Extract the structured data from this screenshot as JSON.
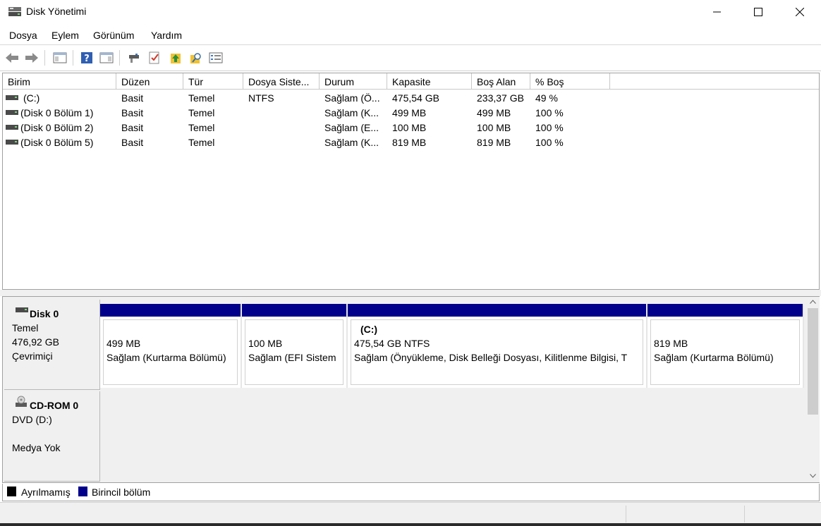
{
  "window": {
    "title": "Disk Yönetimi"
  },
  "menu": [
    "Dosya",
    "Eylem",
    "Görünüm",
    "Yardım"
  ],
  "toolbar": {
    "icons": [
      "back-arrow-icon",
      "forward-arrow-icon",
      "console-tree-icon",
      "help-icon",
      "action-pane-icon",
      "connect-disk-icon",
      "check-icon",
      "rescan-icon",
      "search-icon",
      "properties-icon"
    ]
  },
  "volume_list": {
    "columns": [
      "Birim",
      "Düzen",
      "Tür",
      "Dosya Siste...",
      "Durum",
      "Kapasite",
      "Boş Alan",
      "% Boş"
    ],
    "rows": [
      {
        "birim": "(C:)",
        "duzen": "Basit",
        "tur": "Temel",
        "dosya": "NTFS",
        "durum": "Sağlam (Ö...",
        "kapasite": "475,54 GB",
        "bos": "233,37 GB",
        "yuzde": "49 %"
      },
      {
        "birim": "(Disk 0 Bölüm 1)",
        "duzen": "Basit",
        "tur": "Temel",
        "dosya": "",
        "durum": "Sağlam (K...",
        "kapasite": "499 MB",
        "bos": "499 MB",
        "yuzde": "100 %"
      },
      {
        "birim": "(Disk 0 Bölüm 2)",
        "duzen": "Basit",
        "tur": "Temel",
        "dosya": "",
        "durum": "Sağlam (E...",
        "kapasite": "100 MB",
        "bos": "100 MB",
        "yuzde": "100 %"
      },
      {
        "birim": "(Disk 0 Bölüm 5)",
        "duzen": "Basit",
        "tur": "Temel",
        "dosya": "",
        "durum": "Sağlam (K...",
        "kapasite": "819 MB",
        "bos": "819 MB",
        "yuzde": "100 %"
      }
    ]
  },
  "disks": {
    "disk0": {
      "name": "Disk 0",
      "type": "Temel",
      "size": "476,92 GB",
      "status": "Çevrimiçi",
      "partitions": [
        {
          "label": "",
          "size": "499 MB",
          "status": "Sağlam (Kurtarma Bölümü)"
        },
        {
          "label": "",
          "size": "100 MB",
          "status": "Sağlam (EFI Sistem"
        },
        {
          "label": "(C:)",
          "size": "475,54 GB NTFS",
          "status": "Sağlam (Önyükleme, Disk Belleği Dosyası, Kilitlenme Bilgisi, T"
        },
        {
          "label": "",
          "size": "819 MB",
          "status": "Sağlam (Kurtarma Bölümü)"
        }
      ]
    },
    "cdrom0": {
      "name": "CD-ROM 0",
      "drive": "DVD (D:)",
      "media": "Medya Yok"
    }
  },
  "legend": {
    "unallocated": "Ayrılmamış",
    "primary": "Birincil bölüm"
  },
  "colors": {
    "primary_partition": "#00008b",
    "unallocated": "#000000"
  }
}
